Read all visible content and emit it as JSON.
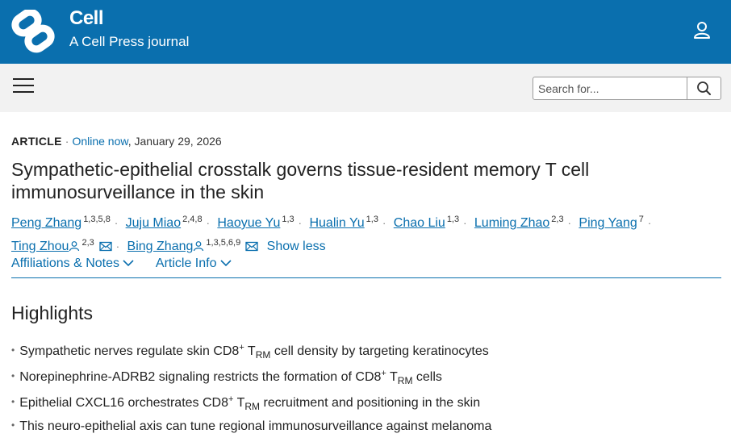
{
  "header": {
    "brand_name": "Cell",
    "brand_sub": "A Cell Press journal"
  },
  "search": {
    "placeholder": "Search for..."
  },
  "article": {
    "type": "ARTICLE",
    "online_label": "Online now",
    "date": "January 29, 2026",
    "title": "Sympathetic-epithelial crosstalk governs tissue-resident memory T cell immunosurveillance in the skin"
  },
  "authors": [
    {
      "name": "Peng Zhang",
      "sup": "1,3,5,8"
    },
    {
      "name": "Juju Miao",
      "sup": "2,4,8"
    },
    {
      "name": "Haoyue Yu",
      "sup": "1,3"
    },
    {
      "name": "Hualin Yu",
      "sup": "1,3"
    },
    {
      "name": "Chao Liu",
      "sup": "1,3"
    },
    {
      "name": "Luming Zhao",
      "sup": "2,3"
    },
    {
      "name": "Ping Yang",
      "sup": "7"
    },
    {
      "name": "Ting Zhou",
      "sup": "2,3"
    },
    {
      "name": "Bing Zhang",
      "sup": "1,3,5,6,9"
    }
  ],
  "show_less": "Show less",
  "tabs": {
    "affiliations": "Affiliations & Notes",
    "article_info": "Article Info"
  },
  "highlights": {
    "title": "Highlights",
    "items": [
      {
        "pre": "Sympathetic nerves regulate skin CD8",
        "sup": "+",
        "t": " T",
        "sub": "RM",
        "post": " cell density by targeting keratinocytes"
      },
      {
        "pre": "Norepinephrine-ADRB2 signaling restricts the formation of CD8",
        "sup": "+",
        "t": " T",
        "sub": "RM",
        "post": " cells"
      },
      {
        "pre": "Epithelial CXCL16 orchestrates CD8",
        "sup": "+",
        "t": " T",
        "sub": "RM",
        "post": " recruitment and positioning in the skin"
      },
      {
        "pre": "This neuro-epithelial axis can tune regional immunosurveillance against melanoma",
        "sup": "",
        "t": "",
        "sub": "",
        "post": ""
      }
    ]
  },
  "colors": {
    "brand": "#0a6fae",
    "navbar": "#f2f2f2"
  }
}
